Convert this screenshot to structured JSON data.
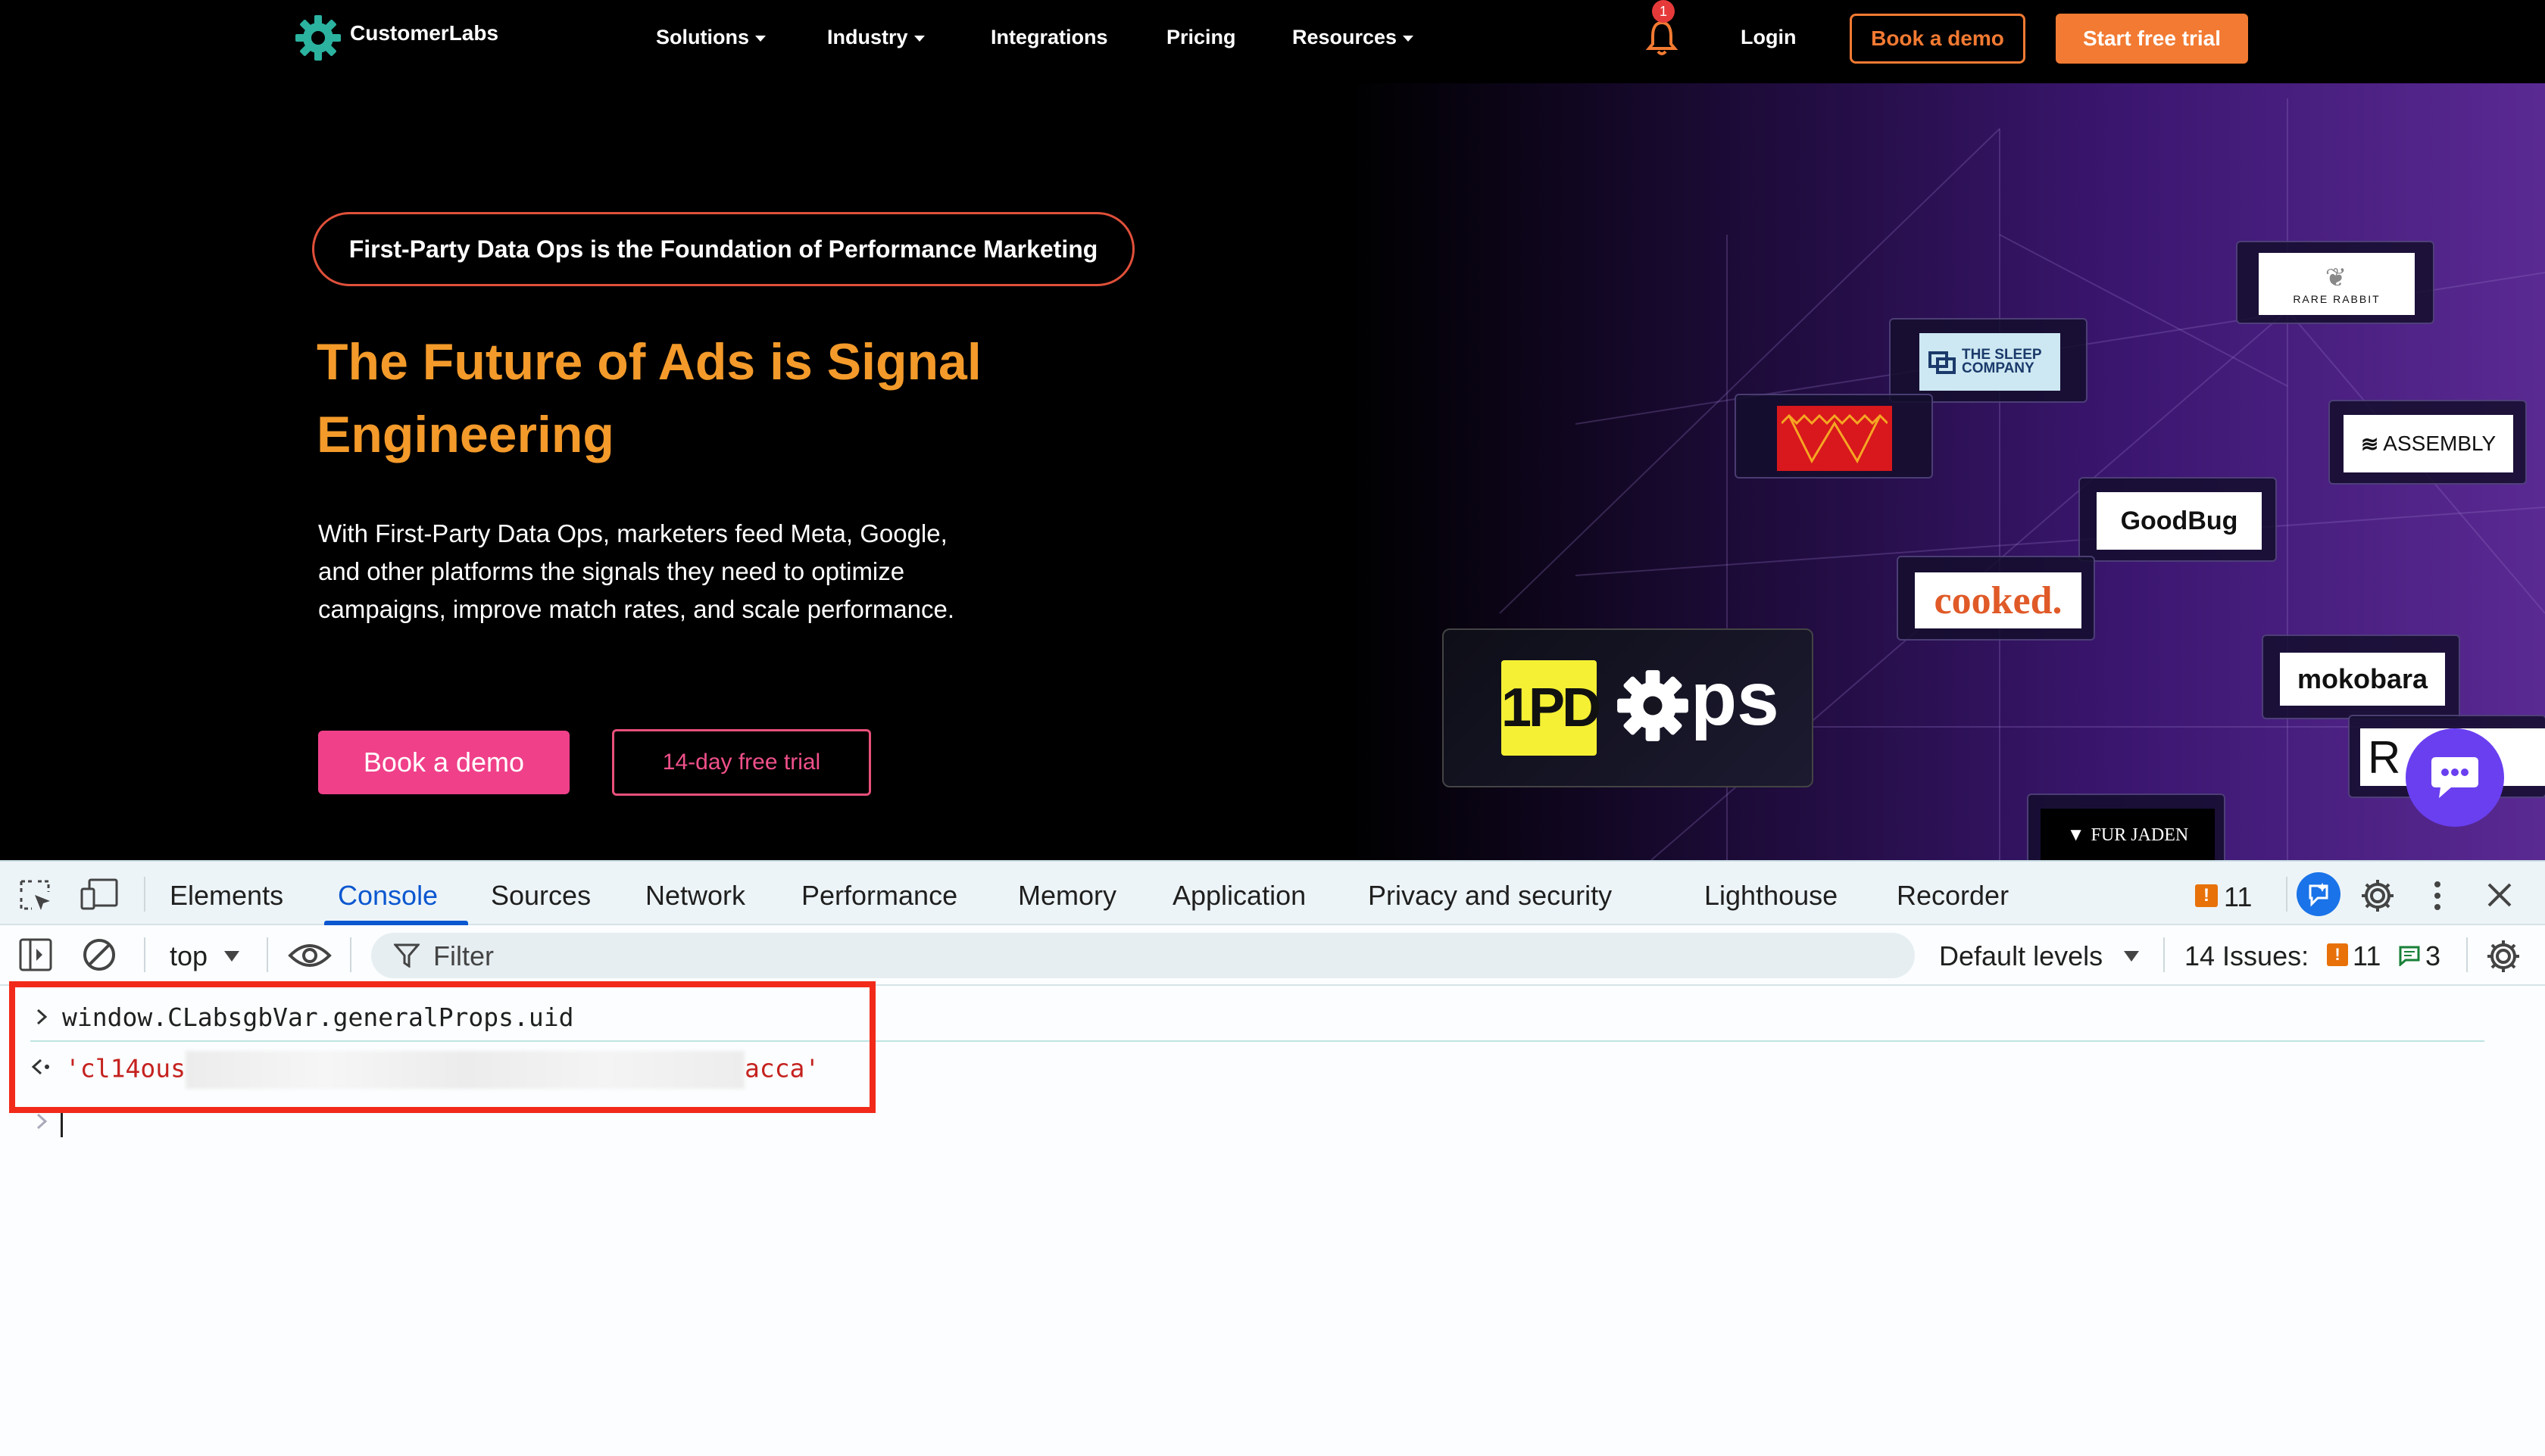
{
  "site": {
    "brand": "CustomerLabs",
    "nav": [
      "Solutions",
      "Industry",
      "Integrations",
      "Pricing",
      "Resources"
    ],
    "notification_count": "1",
    "login": "Login",
    "book_demo": "Book a demo",
    "start_trial": "Start free trial",
    "pill": "First-Party Data Ops is the Foundation of Performance Marketing",
    "headline_1": "The Future of Ads is Signal",
    "headline_2": "Engineering",
    "para_1": "With First-Party Data Ops, marketers feed Meta, Google,",
    "para_2": "and other platforms the signals they need to optimize",
    "para_3": "campaigns, improve match rates, and scale performance.",
    "cta_primary": "Book a demo",
    "cta_secondary": "14-day free trial",
    "logos": {
      "rare_rabbit": "RARE RABBIT",
      "sleep_company_1": "THE SLEEP",
      "sleep_company_2": "COMPANY",
      "assembly": "ASSEMBLY",
      "goodbug": "GoodBug",
      "cooked": "cooked.",
      "mokobara": "mokobara",
      "fur_jaden": "FUR JADEN",
      "ops_1pd": "1PD",
      "ops_text": "ps"
    }
  },
  "devtools": {
    "tabs": [
      "Elements",
      "Console",
      "Sources",
      "Network",
      "Performance",
      "Memory",
      "Application",
      "Privacy and security",
      "Lighthouse",
      "Recorder"
    ],
    "active_tab": "Console",
    "issues_badge": "11",
    "context": "top",
    "filter_placeholder": "Filter",
    "levels": "Default levels",
    "issues_label": "14 Issues:",
    "issues_errors": "11",
    "issues_info": "3",
    "command": "window.CLabsgbVar.generalProps.uid",
    "result_prefix": "'cl14ous",
    "result_suffix": "acca'"
  },
  "colors": {
    "accent_orange": "#f27a32",
    "headline_orange": "#f39a2a",
    "pink": "#f0408a",
    "devtools_blue": "#0b57d0",
    "highlight_red": "#f22a1a"
  }
}
